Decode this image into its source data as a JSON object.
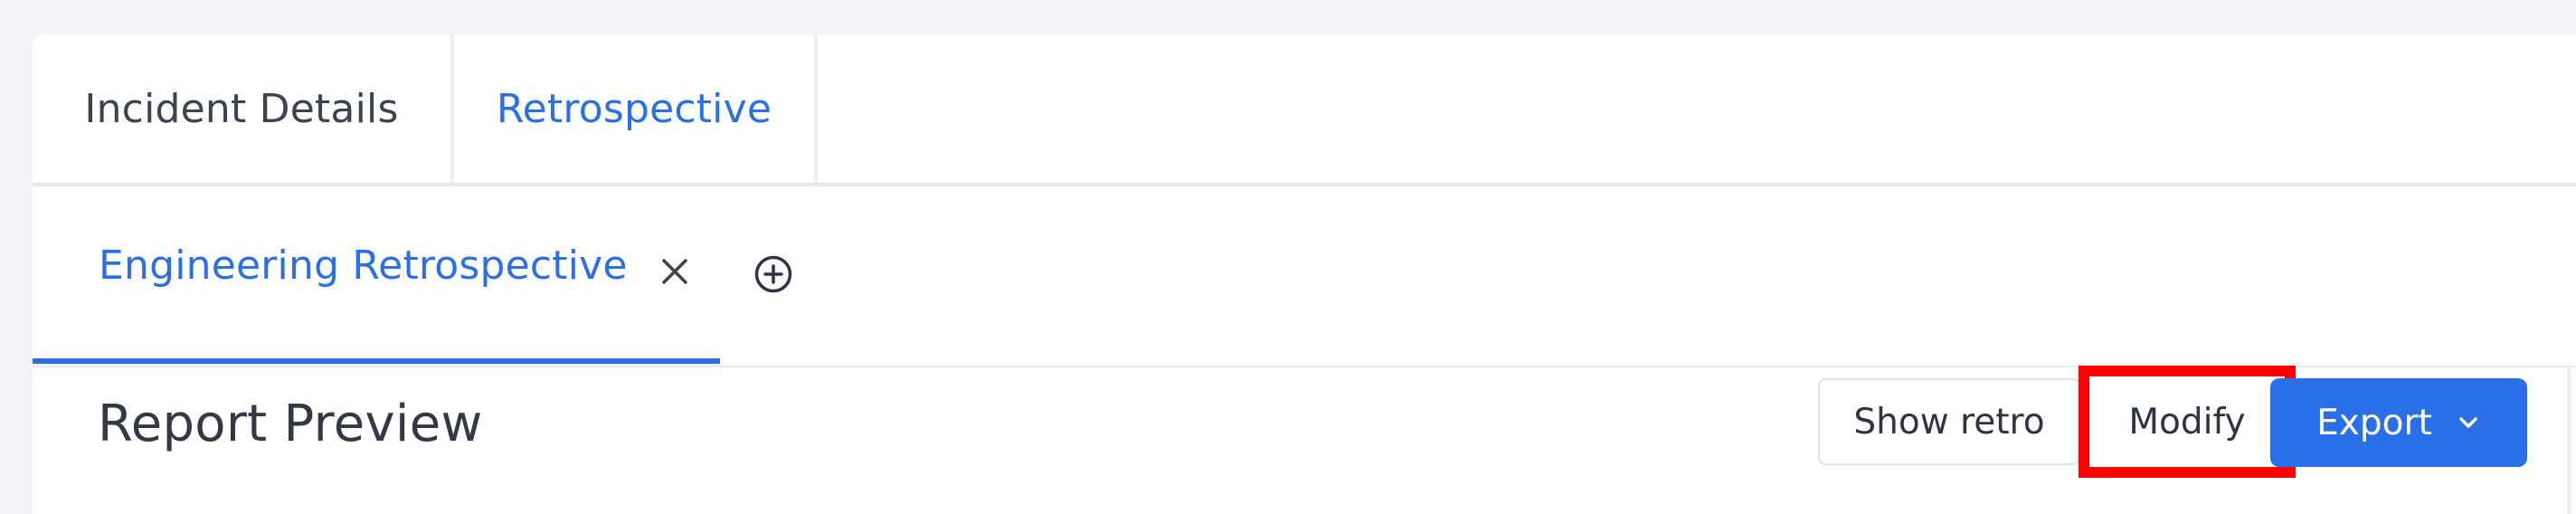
{
  "tabs": {
    "primary": [
      {
        "label": "Incident Details",
        "active": false
      },
      {
        "label": "Retrospective",
        "active": true
      }
    ],
    "secondary": {
      "active_label": "Engineering Retrospective",
      "close_icon": "close-icon",
      "add_icon": "plus-circle-icon"
    }
  },
  "report": {
    "title": "Report Preview",
    "buttons": {
      "show_retro": "Show retro",
      "modify": "Modify",
      "export": "Export",
      "export_icon": "chevron-down-icon"
    }
  },
  "colors": {
    "accent": "#2b6fe8",
    "highlight": "#ff0000",
    "text": "#333844",
    "background": "#f3f4f7"
  }
}
